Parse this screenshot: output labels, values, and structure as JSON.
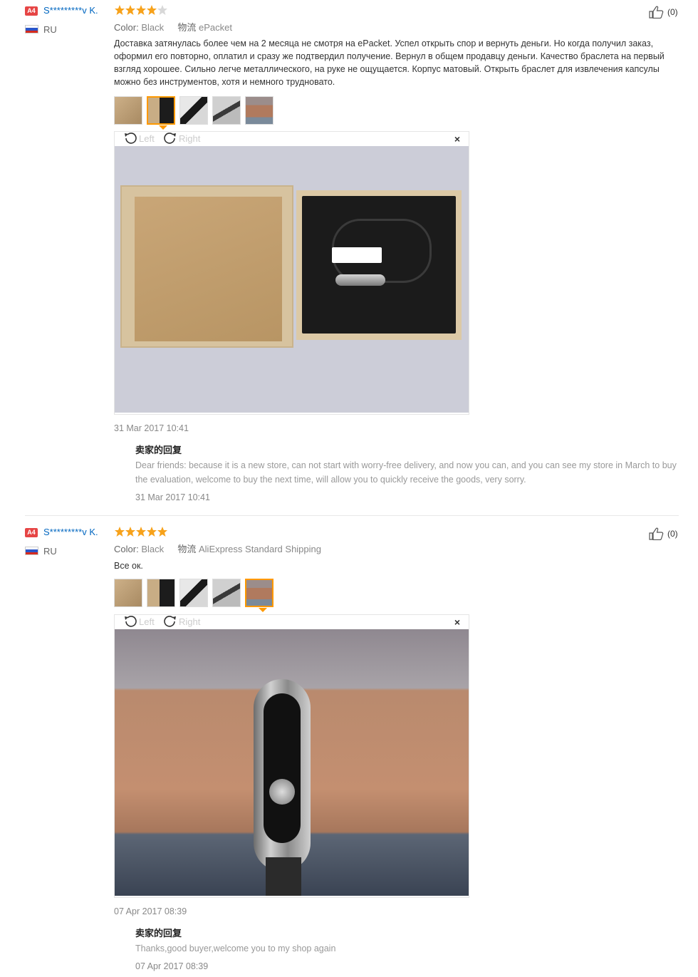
{
  "reviews": [
    {
      "badge": "A4",
      "username": "S*********v K.",
      "country": "RU",
      "rating": 4,
      "helpful": "(0)",
      "color_label": "Color:",
      "color_value": "Black",
      "shipping_label": "物流",
      "shipping_value": "ePacket",
      "text": "Доставка затянулась более чем на 2 месяца не смотря на ePacket. Успел открыть спор и вернуть деньги. Но когда получил заказ, оформил его повторно, оплатил и сразу же подтвердил получение. Вернул в общем продавцу деньги. Качество браслета на первый взгляд хорошее. Сильно легче металлического, на руке не ощущается. Корпус матовый. Открыть браслет для извлечения капсулы можно без инструментов, хотя и немного трудновато.",
      "thumbnails": [
        "box-open",
        "box-band",
        "band-top",
        "band-side",
        "wrist"
      ],
      "active_thumb": 1,
      "rotate_left": "Left",
      "rotate_right": "Right",
      "close": "×",
      "date": "31 Mar 2017 10:41",
      "seller_title": "卖家的回复",
      "seller_text": "Dear friends: because it is a new store, can not start with worry-free delivery, and now you can, and you can see my store in March to buy the evaluation, welcome to buy the next time, will allow you to quickly receive the goods, very sorry.",
      "seller_date": "31 Mar 2017 10:41"
    },
    {
      "badge": "A4",
      "username": "S*********v K.",
      "country": "RU",
      "rating": 5,
      "helpful": "(0)",
      "color_label": "Color:",
      "color_value": "Black",
      "shipping_label": "物流",
      "shipping_value": "AliExpress Standard Shipping",
      "text": "Все ок.",
      "thumbnails": [
        "box-open",
        "box-band",
        "band-top",
        "band-side",
        "wrist"
      ],
      "active_thumb": 4,
      "rotate_left": "Left",
      "rotate_right": "Right",
      "close": "×",
      "date": "07 Apr 2017 08:39",
      "seller_title": "卖家的回复",
      "seller_text": "Thanks,good buyer,welcome you to my shop again",
      "seller_date": "07 Apr 2017 08:39"
    }
  ],
  "colors": {
    "star": "#f7a21b",
    "star_empty": "#d8d8d8",
    "accent": "#ff9900",
    "link": "#0066c0",
    "badge": "#e64545"
  }
}
